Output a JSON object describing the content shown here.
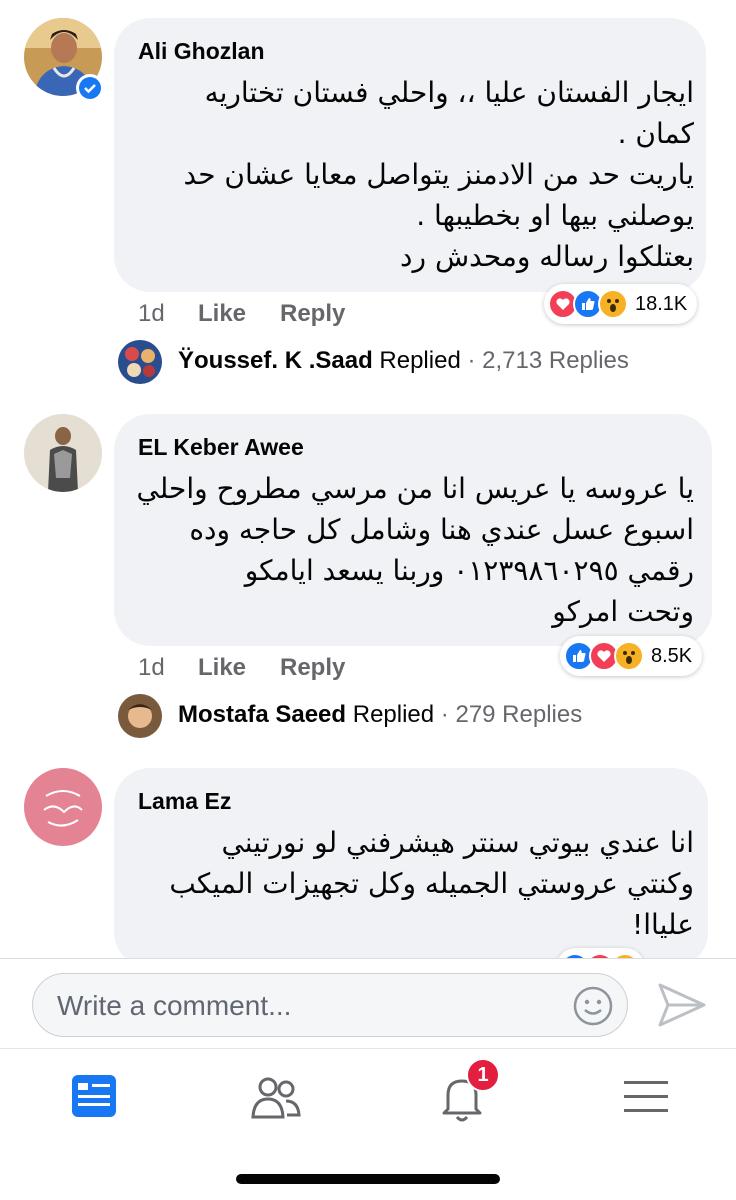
{
  "comments": [
    {
      "author": "Ali Ghozlan",
      "lines": [
        "ايجار الفستان عليا ،، واحلي فستان تختاريه",
        "كمان .",
        "ياريت حد من الادمنز يتواصل معايا عشان حد",
        "يوصلني بيها او بخطيبها .",
        "بعتلكوا رساله ومحدش رد"
      ],
      "time": "1d",
      "like": "Like",
      "reply": "Reply",
      "reaction_count": "18.1K",
      "reply_name": "Ÿoussef. K .Saad",
      "reply_verb": "Replied",
      "reply_sep": "·",
      "reply_count": "2,713 Replies"
    },
    {
      "author": "EL Keber Awee",
      "lines": [
        "يا عروسه يا عريس انا من مرسي مطروح واحلي",
        "اسبوع  عسل عندي هنا وشامل كل حاجه وده",
        "رقمي ٠١٢٣٩٨٦٠٢٩٥   وربنا يسعد ايامكو",
        "وتحت امركو"
      ],
      "time": "1d",
      "like": "Like",
      "reply": "Reply",
      "reaction_count": "8.5K",
      "reply_name": "Mostafa Saeed",
      "reply_verb": "Replied",
      "reply_sep": "·",
      "reply_count": "279 Replies"
    },
    {
      "author": "Lama Ez",
      "lines": [
        "انا عندي بيوتي سنتر هيشرفني لو نورتيني",
        "وكنتي عروستي الجميله وكل تجهيزات الميكب",
        "علياا!"
      ]
    }
  ],
  "composer": {
    "placeholder": "Write a comment..."
  },
  "tabs": {
    "notifications_badge": "1"
  },
  "icons": {
    "home": "news-feed-icon",
    "friends": "friends-icon",
    "notifications": "bell-icon",
    "menu": "menu-icon"
  },
  "colors": {
    "like_blue": "#1877f2",
    "love_red": "#f33e58",
    "wow_yellow": "#f7b125",
    "bubble": "#f0f2f5"
  }
}
